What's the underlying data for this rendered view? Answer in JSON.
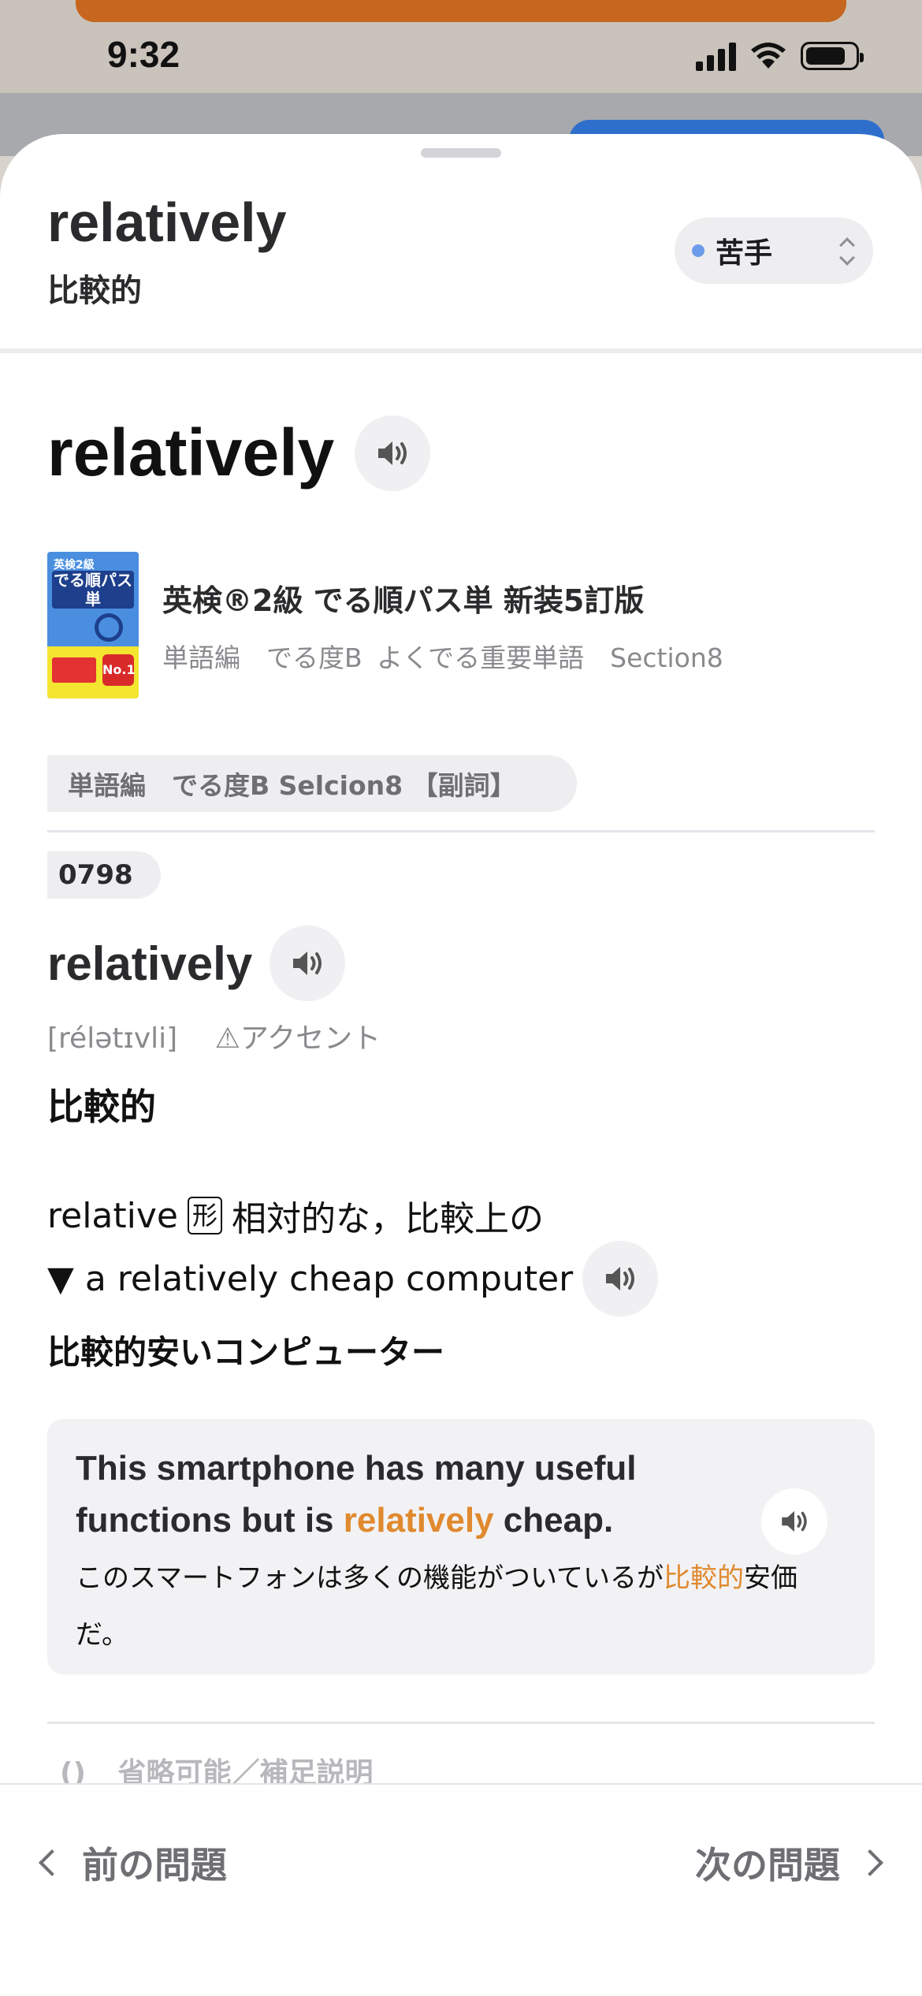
{
  "status_bar": {
    "time": "9:32"
  },
  "sheet": {
    "title": "relatively",
    "subtitle": "比較的",
    "status_select": {
      "value": "苦手",
      "dot_color": "#6d9bea"
    }
  },
  "headword": {
    "word": "relatively"
  },
  "book": {
    "title": "英検®2級 でる順パス単 新装5訂版",
    "meta": "単語編　でる度B よくでる重要単語　Section8",
    "cover": {
      "series": "英検2級",
      "label": "でる順パス単",
      "badge": "No.1"
    }
  },
  "section_label": "単語編　でる度B Selcion8 【副詞】",
  "entry": {
    "number": "0798",
    "word": "relatively",
    "pronunciation": "[rélətɪvli]",
    "accent_note": "⚠アクセント",
    "meaning": "比較的",
    "derivative": {
      "word": "relative",
      "pos": "形",
      "meaning": "相対的な，比較上の"
    },
    "phrase": {
      "marker": "▼",
      "en": "a relatively cheap computer",
      "ja": "比較的安いコンピューター"
    }
  },
  "example": {
    "en_before": "This smartphone has many useful functions but is ",
    "en_highlight": "relatively",
    "en_after": " cheap.",
    "ja_before": "このスマートフォンは多くの機能がついているが",
    "ja_highlight": "比較的",
    "ja_after": "安価だ。",
    "highlight_color": "#e0892e"
  },
  "legend": {
    "paren": "()",
    "text": "省略可能／補足説明"
  },
  "nav": {
    "prev_label": "前の問題",
    "next_label": "次の問題"
  }
}
